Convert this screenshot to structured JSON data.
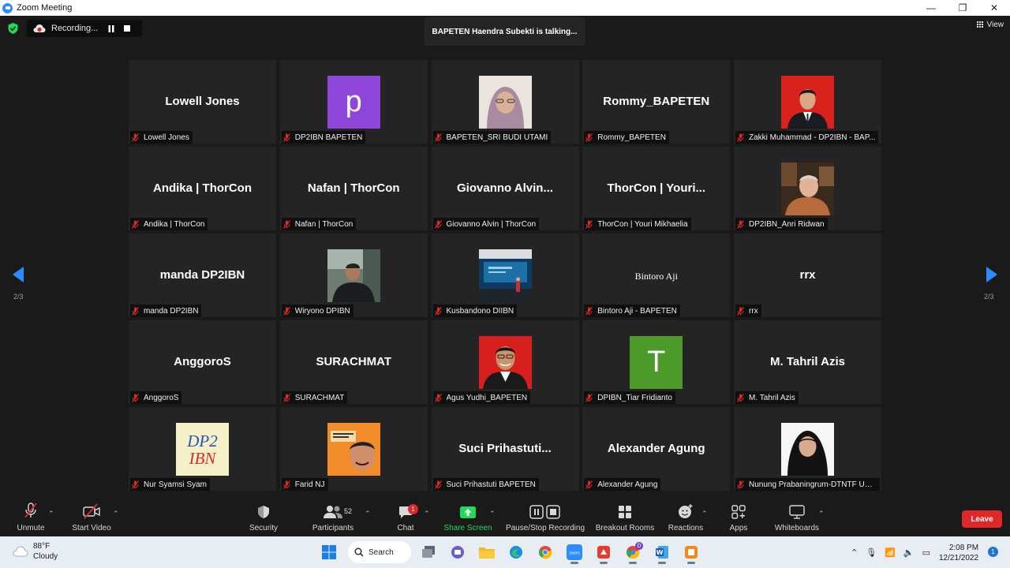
{
  "window": {
    "title": "Zoom Meeting",
    "minimize_glyph": "—",
    "maximize_glyph": "❐",
    "close_glyph": "✕"
  },
  "meeting": {
    "recording_label": "Recording...",
    "talking_banner": "BAPETEN Haendra Subekti is talking...",
    "view_label": "View",
    "page_indicator": "2/3"
  },
  "participants": [
    {
      "display": "Lowell Jones",
      "name": "Lowell Jones",
      "kind": "text"
    },
    {
      "display": "p",
      "name": "DP2IBN BAPETEN",
      "kind": "letter",
      "color": "#8e45d8"
    },
    {
      "display": "",
      "name": "BAPETEN_SRI BUDI UTAMI",
      "kind": "photo",
      "photo": "hijab-woman"
    },
    {
      "display": "Rommy_BAPETEN",
      "name": "Rommy_BAPETEN",
      "kind": "text"
    },
    {
      "display": "",
      "name": "Zakki Muhammad - DP2IBN - BAP...",
      "kind": "photo",
      "photo": "man-red-bg"
    },
    {
      "display": "Andika | ThorCon",
      "name": "Andika | ThorCon",
      "kind": "text"
    },
    {
      "display": "Nafan | ThorCon",
      "name": "Nafan | ThorCon",
      "kind": "text"
    },
    {
      "display": "Giovanno  Alvin...",
      "name": "Giovanno Alvin | ThorCon",
      "kind": "text"
    },
    {
      "display": "ThorCon | Youri...",
      "name": "ThorCon | Youri Mikhaelia",
      "kind": "text"
    },
    {
      "display": "",
      "name": "DP2IBN_Anri Ridwan",
      "kind": "photo",
      "photo": "older-man"
    },
    {
      "display": "manda DP2IBN",
      "name": "manda DP2IBN",
      "kind": "text"
    },
    {
      "display": "",
      "name": "Wiryono DPIBN",
      "kind": "photo",
      "photo": "man-outdoor"
    },
    {
      "display": "",
      "name": "Kusbandono DIIBN",
      "kind": "photo",
      "photo": "stage"
    },
    {
      "display": "Bintoro Aji",
      "name": "Bintoro Aji - BAPETEN",
      "kind": "serif"
    },
    {
      "display": "rrx",
      "name": "rrx",
      "kind": "text"
    },
    {
      "display": "AnggoroS",
      "name": "AnggoroS",
      "kind": "text"
    },
    {
      "display": "SURACHMAT",
      "name": "SURACHMAT",
      "kind": "text"
    },
    {
      "display": "",
      "name": "Agus Yudhi_BAPETEN",
      "kind": "photo",
      "photo": "man-red-bg2"
    },
    {
      "display": "T",
      "name": "DPIBN_Tiar Fridianto",
      "kind": "letter",
      "color": "#4c9a2a"
    },
    {
      "display": "M. Tahril Azis",
      "name": "M. Tahril Azis",
      "kind": "text"
    },
    {
      "display": "",
      "name": "Nur Syamsi Syam",
      "kind": "photo",
      "photo": "dp2ibn-logo",
      "logo_line1": "DP2",
      "logo_line2": "IBN"
    },
    {
      "display": "",
      "name": "Farid NJ",
      "kind": "photo",
      "photo": "poster-man"
    },
    {
      "display": "Suci  Prihastuti...",
      "name": "Suci Prihastuti BAPETEN",
      "kind": "text"
    },
    {
      "display": "Alexander Agung",
      "name": "Alexander Agung",
      "kind": "text"
    },
    {
      "display": "",
      "name": "Nunung Prabaningrum-DTNTF UG...",
      "kind": "photo",
      "photo": "hijab-woman2"
    }
  ],
  "toolbar": {
    "unmute": "Unmute",
    "start_video": "Start Video",
    "security": "Security",
    "participants": "Participants",
    "participants_count": "52",
    "chat": "Chat",
    "chat_badge": "1",
    "share_screen": "Share Screen",
    "pause_stop_recording": "Pause/Stop Recording",
    "breakout_rooms": "Breakout Rooms",
    "reactions": "Reactions",
    "apps": "Apps",
    "whiteboards": "Whiteboards",
    "leave": "Leave",
    "accent_green": "#23d959",
    "leave_color": "#e02828"
  },
  "taskbar": {
    "temperature": "88°F",
    "weather": "Cloudy",
    "search": "Search",
    "time": "2:08 PM",
    "date": "12/21/2022",
    "notification_count": "1",
    "chrome_badge": "D"
  }
}
